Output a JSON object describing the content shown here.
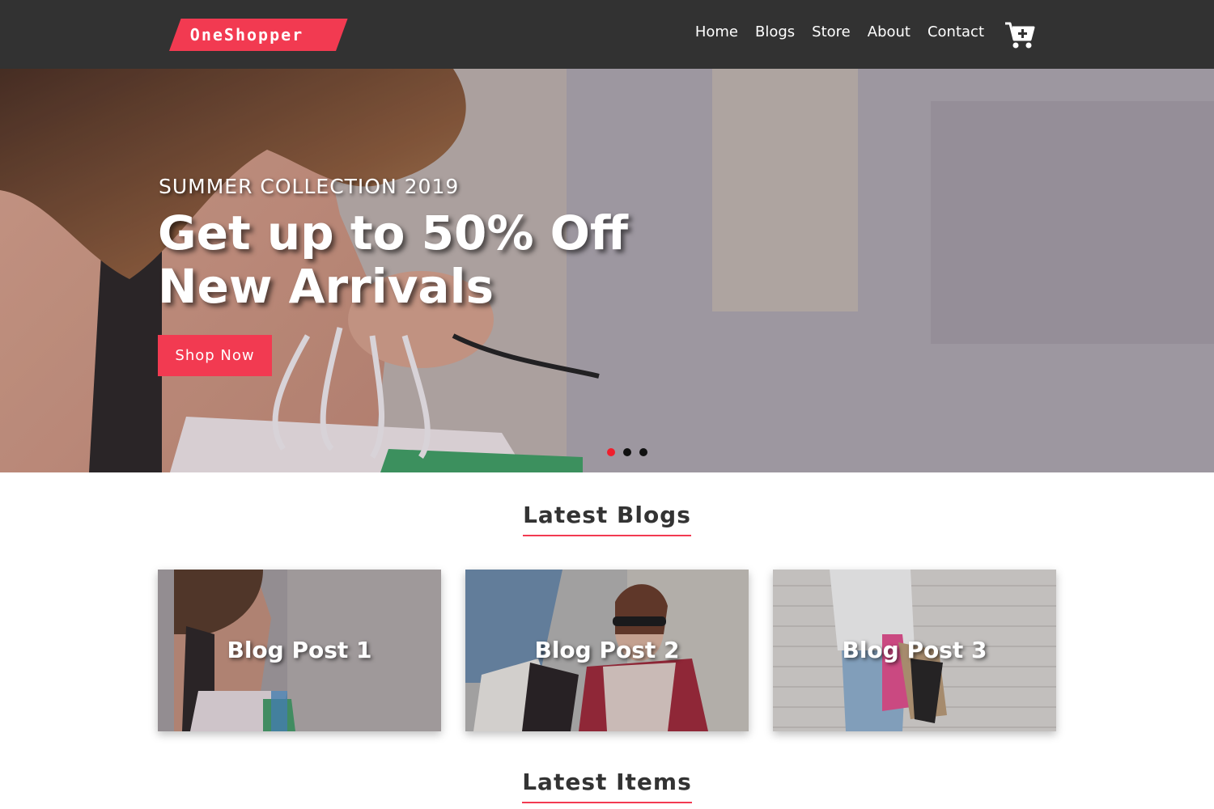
{
  "brand": {
    "name": "OneShopper",
    "accent": "#f23a51",
    "nav_bg": "#323232"
  },
  "nav": {
    "items": [
      {
        "label": "Home"
      },
      {
        "label": "Blogs"
      },
      {
        "label": "Store"
      },
      {
        "label": "About"
      },
      {
        "label": "Contact"
      }
    ],
    "cart_icon": "cart-plus-icon"
  },
  "hero": {
    "subtitle": "SUMMER COLLECTION 2019",
    "title": "Get up to 50% Off New Arrivals",
    "button_label": "Shop Now",
    "slides": 3,
    "active_slide": 1,
    "dot_active_color": "#f01e2c"
  },
  "blogs": {
    "heading": "Latest Blogs",
    "posts": [
      {
        "title": "Blog Post 1"
      },
      {
        "title": "Blog Post 2"
      },
      {
        "title": "Blog Post 3"
      }
    ]
  },
  "items": {
    "heading": "Latest Items"
  }
}
